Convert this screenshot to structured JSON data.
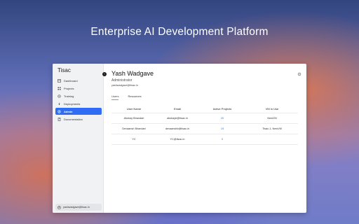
{
  "hero": {
    "title": "Enterprise AI Development Platform"
  },
  "sidebar": {
    "brand": "Tisac",
    "items": [
      {
        "label": "Dashboard",
        "icon": "dashboard-icon"
      },
      {
        "label": "Projects",
        "icon": "grid-icon"
      },
      {
        "label": "Training",
        "icon": "training-icon"
      },
      {
        "label": "Deployments",
        "icon": "rocket-icon"
      },
      {
        "label": "Admin",
        "icon": "gear-icon",
        "active": true
      },
      {
        "label": "Documentation",
        "icon": "book-icon"
      }
    ],
    "user_email": "yashwadgave@tisac.in"
  },
  "profile": {
    "name": "Yash Wadgave",
    "role": "Administrator",
    "email": "yashwadgave@tisac.in"
  },
  "tabs": [
    {
      "label": "Users",
      "active": true
    },
    {
      "label": "Resources"
    }
  ],
  "table": {
    "headers": [
      "User Name",
      "Email",
      "Active Projects",
      "VM in Use"
    ],
    "rows": [
      {
        "name": "Akshay Bhandari",
        "email": "akshayb@tisac.in",
        "projects": "20",
        "vm": "NewVM"
      },
      {
        "name": "Devaansh Bhandari",
        "email": "devaanshb@tisac.in",
        "projects": "19",
        "vm": "Tisac-1, NewVM"
      },
      {
        "name": "YC",
        "email": "YC@tisac.in",
        "projects": "0",
        "vm": ""
      }
    ]
  },
  "colors": {
    "accent": "#2f6ef4",
    "link": "#3f6fd0"
  }
}
